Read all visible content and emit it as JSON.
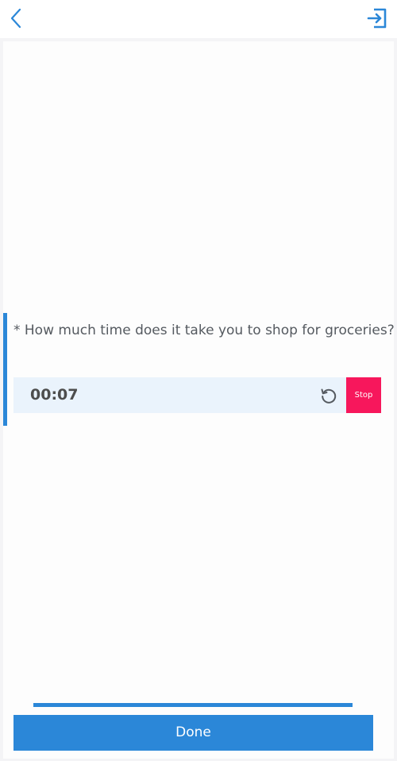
{
  "header": {
    "back_icon": "chevron-left-icon",
    "exit_icon": "exit-arrow-icon"
  },
  "question": {
    "text": "* How much time does it take you to shop for groceries?",
    "timer_value": "00:07",
    "reset_icon": "refresh-icon",
    "stop_label": "Stop"
  },
  "footer": {
    "progress": 1.0,
    "done_label": "Done"
  },
  "colors": {
    "accent": "#2b87d8",
    "stop": "#f7175c",
    "timer_background": "#eaf3fc"
  }
}
